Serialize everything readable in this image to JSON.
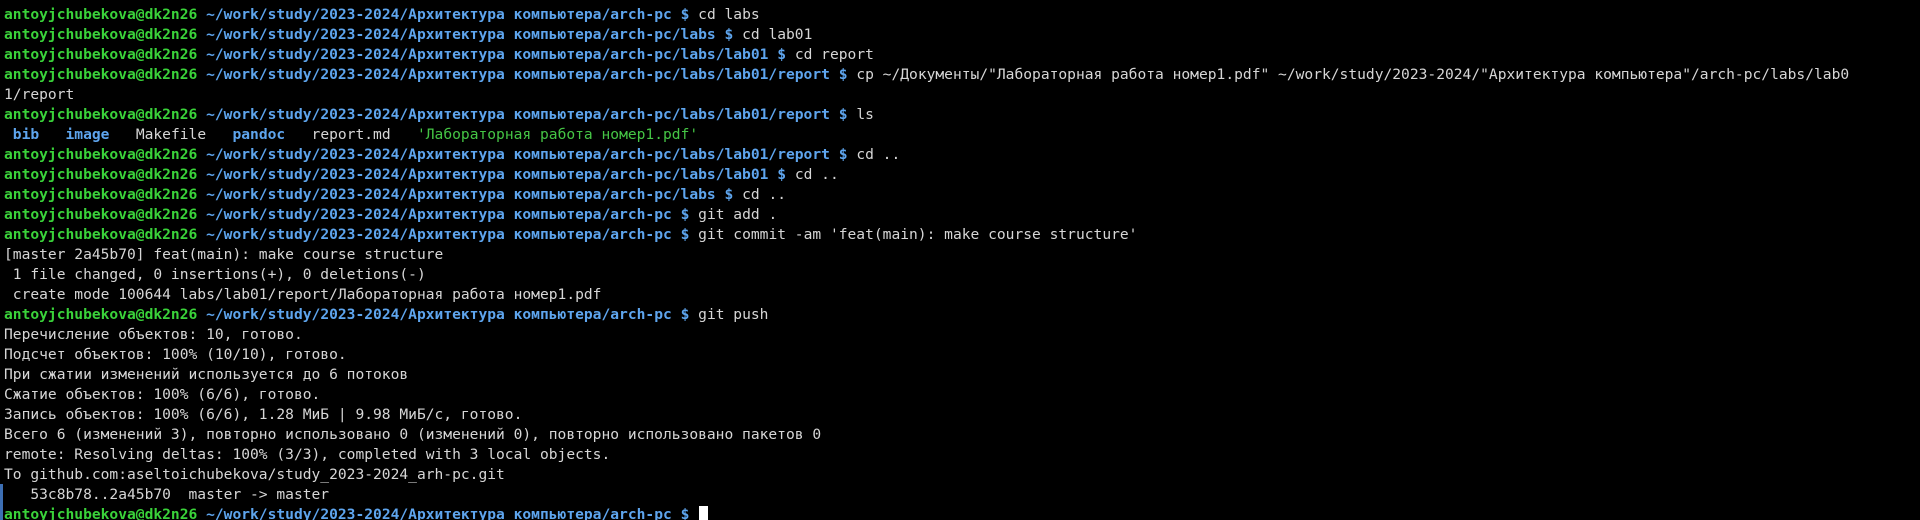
{
  "prompt": {
    "user": "antoyjchubekova@dk2n26",
    "symbol": "$"
  },
  "lines": [
    {
      "path": "~/work/study/2023-2024/Архитектура компьютера/arch-pc",
      "cmd": "cd labs"
    },
    {
      "path": "~/work/study/2023-2024/Архитектура компьютера/arch-pc/labs",
      "cmd": "cd lab01"
    },
    {
      "path": "~/work/study/2023-2024/Архитектура компьютера/arch-pc/labs/lab01",
      "cmd": "cd report"
    },
    {
      "path": "~/work/study/2023-2024/Архитектура компьютера/arch-pc/labs/lab01/report",
      "cmd": "cp ~/Документы/\"Лабораторная работа номер1.pdf\" ~/work/study/2023-2024/\"Архитектура компьютера\"/arch-pc/labs/lab0"
    },
    {
      "output": "1/report"
    },
    {
      "path": "~/work/study/2023-2024/Архитектура компьютера/arch-pc/labs/lab01/report",
      "cmd": "ls"
    },
    {
      "ls": true
    },
    {
      "path": "~/work/study/2023-2024/Архитектура компьютера/arch-pc/labs/lab01/report",
      "cmd": "cd .."
    },
    {
      "path": "~/work/study/2023-2024/Архитектура компьютера/arch-pc/labs/lab01",
      "cmd": "cd .."
    },
    {
      "path": "~/work/study/2023-2024/Архитектура компьютера/arch-pc/labs",
      "cmd": "cd .."
    },
    {
      "path": "~/work/study/2023-2024/Архитектура компьютера/arch-pc",
      "cmd": "git add ."
    },
    {
      "path": "~/work/study/2023-2024/Архитектура компьютера/arch-pc",
      "cmd": "git commit -am 'feat(main): make course structure'"
    },
    {
      "output": "[master 2a45b70] feat(main): make course structure"
    },
    {
      "output": " 1 file changed, 0 insertions(+), 0 deletions(-)"
    },
    {
      "output": " create mode 100644 labs/lab01/report/Лабораторная работа номер1.pdf"
    },
    {
      "path": "~/work/study/2023-2024/Архитектура компьютера/arch-pc",
      "cmd": "git push"
    },
    {
      "output": "Перечисление объектов: 10, готово."
    },
    {
      "output": "Подсчет объектов: 100% (10/10), готово."
    },
    {
      "output": "При сжатии изменений используется до 6 потоков"
    },
    {
      "output": "Сжатие объектов: 100% (6/6), готово."
    },
    {
      "output": "Запись объектов: 100% (6/6), 1.28 МиБ | 9.98 МиБ/с, готово."
    },
    {
      "output": "Всего 6 (изменений 3), повторно использовано 0 (изменений 0), повторно использовано пакетов 0"
    },
    {
      "output": "remote: Resolving deltas: 100% (3/3), completed with 3 local objects."
    },
    {
      "output": "To github.com:aseltoichubekova/study_2023-2024_arh-pc.git"
    },
    {
      "output": "   53c8b78..2a45b70  master -> master"
    },
    {
      "path": "~/work/study/2023-2024/Архитектура компьютера/arch-pc",
      "cmd": "",
      "cursor": true
    }
  ],
  "ls_output": {
    "dirs": [
      "bib",
      "image"
    ],
    "files": [
      "Makefile"
    ],
    "dirs2": [
      "pandoc"
    ],
    "files2": [
      "report.md"
    ],
    "pdf": "'Лабораторная работа номер1.pdf'"
  },
  "colors": {
    "background": "#000000",
    "user": "#3ad33a",
    "path": "#5ea5ee",
    "text": "#d6d6d6",
    "pdf": "#45c545"
  }
}
